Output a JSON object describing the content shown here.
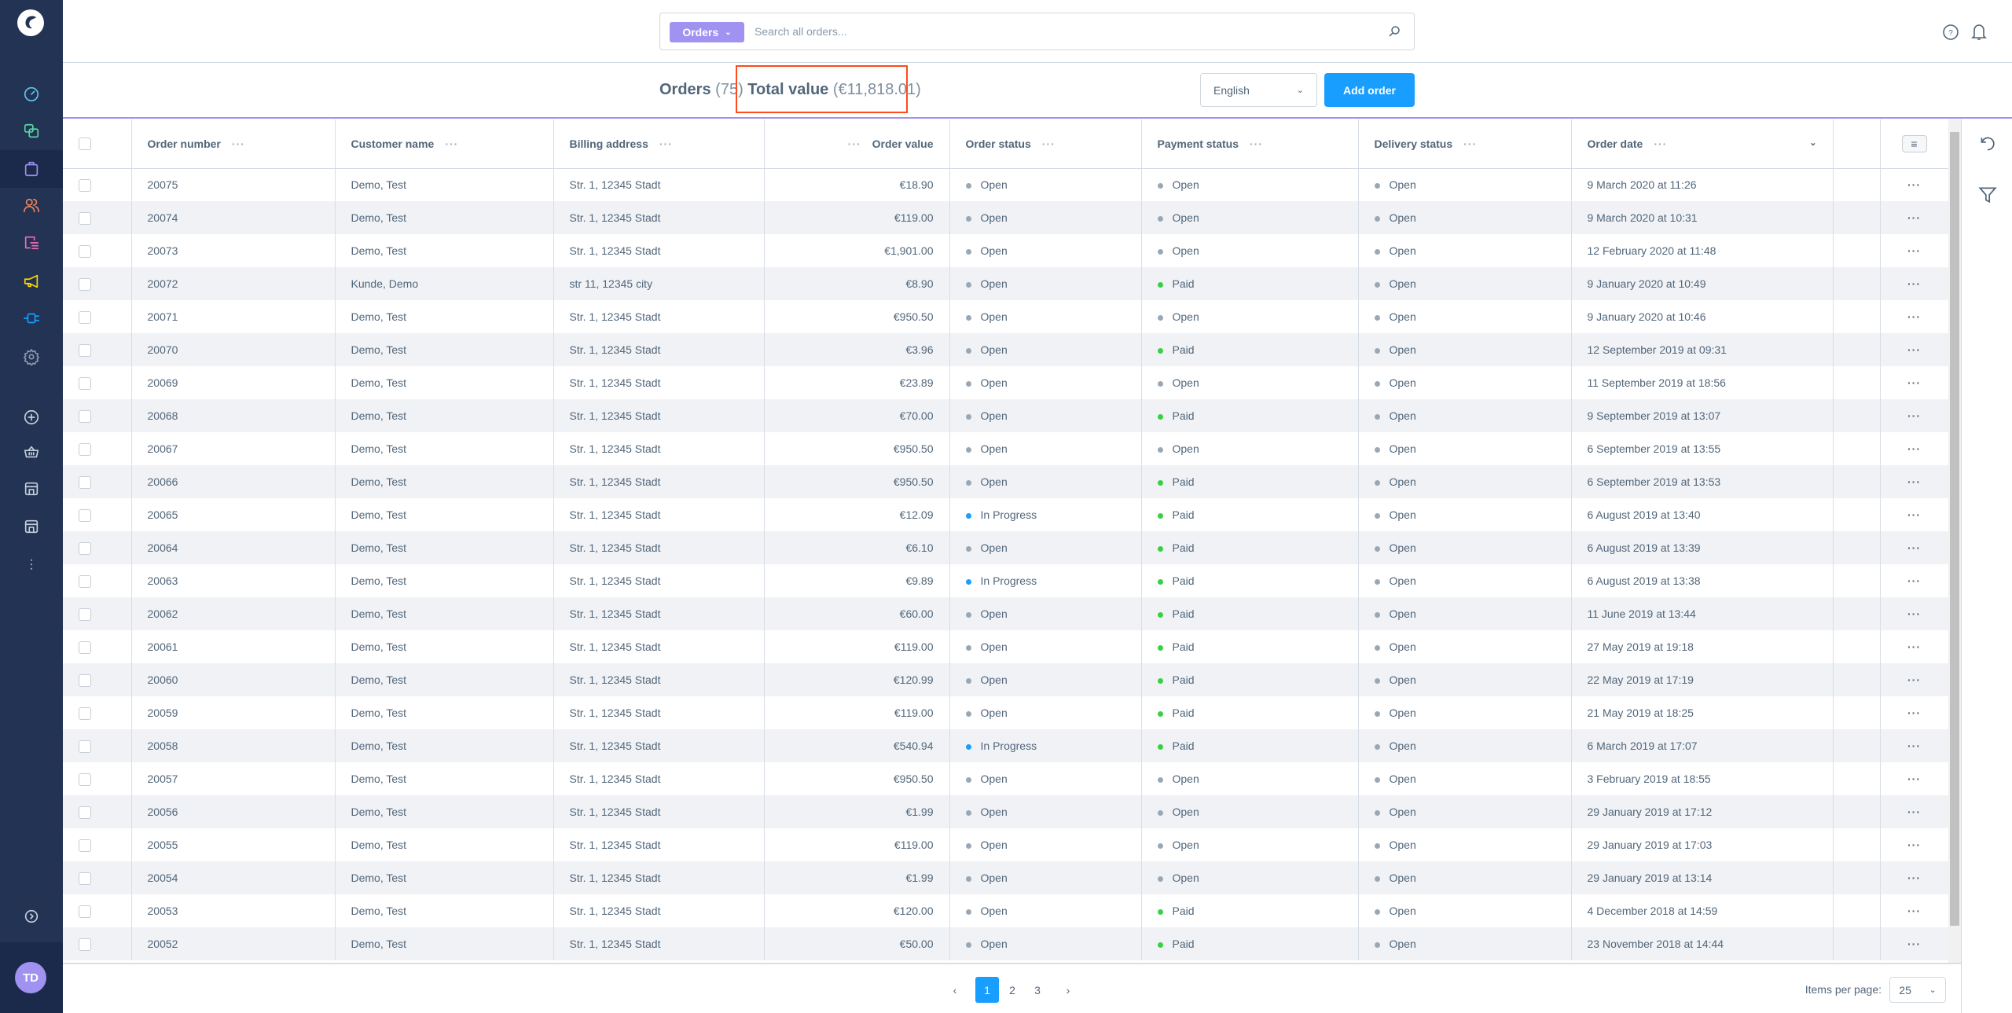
{
  "search": {
    "type_label": "Orders",
    "placeholder": "Search all orders..."
  },
  "header": {
    "title": "Orders",
    "count": "(75)",
    "total_label": "Total value",
    "total_value": "(€11,818.01)"
  },
  "language": "English",
  "add_order_label": "Add order",
  "user_initials": "TD",
  "colors": {
    "accent": "#189eff",
    "purple": "#a092f0",
    "sidebar": "#233354",
    "open": "#9aa8b5",
    "paid": "#37d046",
    "in_progress": "#189eff",
    "highlight": "#ff4a1c"
  },
  "columns": [
    "Order number",
    "Customer name",
    "Billing address",
    "Order value",
    "Order status",
    "Payment status",
    "Delivery status",
    "Order date"
  ],
  "rows": [
    [
      "20075",
      "Demo, Test",
      "Str. 1, 12345 Stadt",
      "€18.90",
      "Open",
      "Open",
      "Open",
      "9 March 2020 at 11:26"
    ],
    [
      "20074",
      "Demo, Test",
      "Str. 1, 12345 Stadt",
      "€119.00",
      "Open",
      "Open",
      "Open",
      "9 March 2020 at 10:31"
    ],
    [
      "20073",
      "Demo, Test",
      "Str. 1, 12345 Stadt",
      "€1,901.00",
      "Open",
      "Open",
      "Open",
      "12 February 2020 at 11:48"
    ],
    [
      "20072",
      "Kunde, Demo",
      "str 11, 12345 city",
      "€8.90",
      "Open",
      "Paid",
      "Open",
      "9 January 2020 at 10:49"
    ],
    [
      "20071",
      "Demo, Test",
      "Str. 1, 12345 Stadt",
      "€950.50",
      "Open",
      "Open",
      "Open",
      "9 January 2020 at 10:46"
    ],
    [
      "20070",
      "Demo, Test",
      "Str. 1, 12345 Stadt",
      "€3.96",
      "Open",
      "Paid",
      "Open",
      "12 September 2019 at 09:31"
    ],
    [
      "20069",
      "Demo, Test",
      "Str. 1, 12345 Stadt",
      "€23.89",
      "Open",
      "Open",
      "Open",
      "11 September 2019 at 18:56"
    ],
    [
      "20068",
      "Demo, Test",
      "Str. 1, 12345 Stadt",
      "€70.00",
      "Open",
      "Paid",
      "Open",
      "9 September 2019 at 13:07"
    ],
    [
      "20067",
      "Demo, Test",
      "Str. 1, 12345 Stadt",
      "€950.50",
      "Open",
      "Open",
      "Open",
      "6 September 2019 at 13:55"
    ],
    [
      "20066",
      "Demo, Test",
      "Str. 1, 12345 Stadt",
      "€950.50",
      "Open",
      "Paid",
      "Open",
      "6 September 2019 at 13:53"
    ],
    [
      "20065",
      "Demo, Test",
      "Str. 1, 12345 Stadt",
      "€12.09",
      "In Progress",
      "Paid",
      "Open",
      "6 August 2019 at 13:40"
    ],
    [
      "20064",
      "Demo, Test",
      "Str. 1, 12345 Stadt",
      "€6.10",
      "Open",
      "Paid",
      "Open",
      "6 August 2019 at 13:39"
    ],
    [
      "20063",
      "Demo, Test",
      "Str. 1, 12345 Stadt",
      "€9.89",
      "In Progress",
      "Paid",
      "Open",
      "6 August 2019 at 13:38"
    ],
    [
      "20062",
      "Demo, Test",
      "Str. 1, 12345 Stadt",
      "€60.00",
      "Open",
      "Paid",
      "Open",
      "11 June 2019 at 13:44"
    ],
    [
      "20061",
      "Demo, Test",
      "Str. 1, 12345 Stadt",
      "€119.00",
      "Open",
      "Paid",
      "Open",
      "27 May 2019 at 19:18"
    ],
    [
      "20060",
      "Demo, Test",
      "Str. 1, 12345 Stadt",
      "€120.99",
      "Open",
      "Paid",
      "Open",
      "22 May 2019 at 17:19"
    ],
    [
      "20059",
      "Demo, Test",
      "Str. 1, 12345 Stadt",
      "€119.00",
      "Open",
      "Paid",
      "Open",
      "21 May 2019 at 18:25"
    ],
    [
      "20058",
      "Demo, Test",
      "Str. 1, 12345 Stadt",
      "€540.94",
      "In Progress",
      "Paid",
      "Open",
      "6 March 2019 at 17:07"
    ],
    [
      "20057",
      "Demo, Test",
      "Str. 1, 12345 Stadt",
      "€950.50",
      "Open",
      "Open",
      "Open",
      "3 February 2019 at 18:55"
    ],
    [
      "20056",
      "Demo, Test",
      "Str. 1, 12345 Stadt",
      "€1.99",
      "Open",
      "Open",
      "Open",
      "29 January 2019 at 17:12"
    ],
    [
      "20055",
      "Demo, Test",
      "Str. 1, 12345 Stadt",
      "€119.00",
      "Open",
      "Open",
      "Open",
      "29 January 2019 at 17:03"
    ],
    [
      "20054",
      "Demo, Test",
      "Str. 1, 12345 Stadt",
      "€1.99",
      "Open",
      "Open",
      "Open",
      "29 January 2019 at 13:14"
    ],
    [
      "20053",
      "Demo, Test",
      "Str. 1, 12345 Stadt",
      "€120.00",
      "Open",
      "Paid",
      "Open",
      "4 December 2018 at 14:59"
    ],
    [
      "20052",
      "Demo, Test",
      "Str. 1, 12345 Stadt",
      "€50.00",
      "Open",
      "Paid",
      "Open",
      "23 November 2018 at 14:44"
    ]
  ],
  "row_action": "···",
  "column_menu": "···",
  "pagination": {
    "pages": [
      "1",
      "2",
      "3"
    ],
    "current": "1",
    "items_per_page_label": "Items per page:",
    "items_per_page": "25"
  }
}
